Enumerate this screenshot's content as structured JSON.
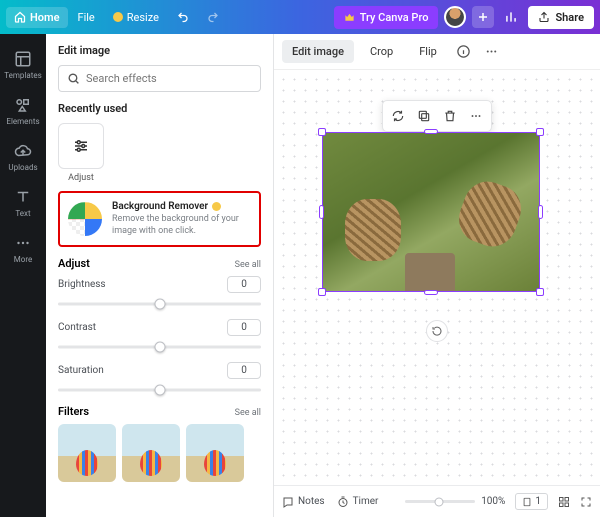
{
  "topbar": {
    "home": "Home",
    "file": "File",
    "resize": "Resize",
    "try_pro": "Try Canva Pro",
    "share": "Share"
  },
  "rail": {
    "templates": "Templates",
    "elements": "Elements",
    "uploads": "Uploads",
    "text": "Text",
    "more": "More"
  },
  "panel": {
    "title": "Edit image",
    "search_placeholder": "Search effects",
    "recently_used": "Recently used",
    "adjust_tile": "Adjust",
    "bg_remover": {
      "title": "Background Remover",
      "desc": "Remove the background of your image with one click."
    },
    "adjust": {
      "heading": "Adjust",
      "see_all": "See all",
      "brightness": {
        "label": "Brightness",
        "value": "0"
      },
      "contrast": {
        "label": "Contrast",
        "value": "0"
      },
      "saturation": {
        "label": "Saturation",
        "value": "0"
      }
    },
    "filters": {
      "heading": "Filters",
      "see_all": "See all"
    }
  },
  "context": {
    "edit_image": "Edit image",
    "crop": "Crop",
    "flip": "Flip"
  },
  "bottom": {
    "notes": "Notes",
    "timer": "Timer",
    "zoom": "100%",
    "pages": "1"
  }
}
